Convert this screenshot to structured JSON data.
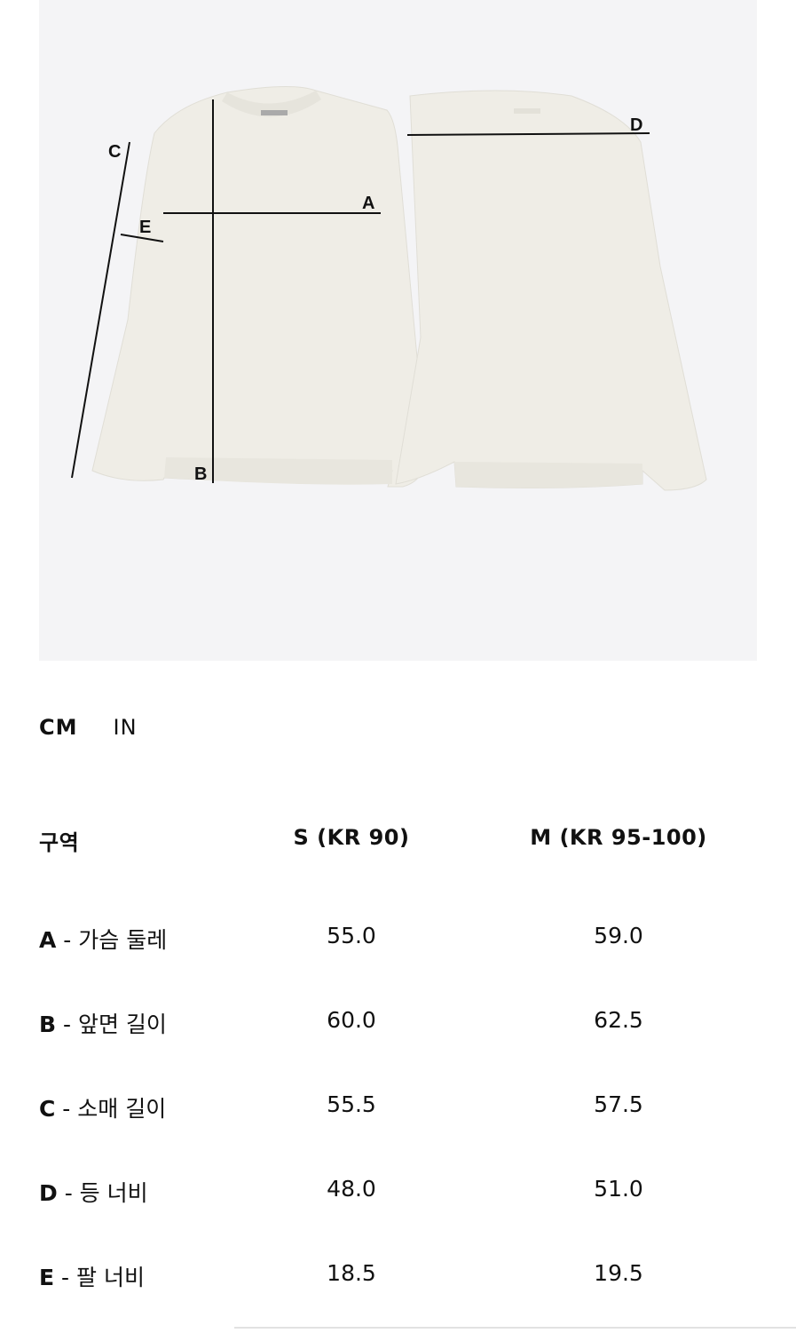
{
  "figure": {
    "labels": {
      "a": "A",
      "b": "B",
      "c": "C",
      "d": "D",
      "e": "E"
    }
  },
  "units": {
    "cm": "CM",
    "in": "IN"
  },
  "table": {
    "headers": [
      "구역",
      "S (KR 90)",
      "M (KR 95-100)"
    ],
    "rows": [
      {
        "letter": "A",
        "label": " - 가슴 둘레",
        "s": "55.0",
        "m": "59.0"
      },
      {
        "letter": "B",
        "label": " - 앞면 길이",
        "s": "60.0",
        "m": "62.5"
      },
      {
        "letter": "C",
        "label": " - 소매 길이",
        "s": "55.5",
        "m": "57.5"
      },
      {
        "letter": "D",
        "label": " - 등 너비",
        "s": "48.0",
        "m": "51.0"
      },
      {
        "letter": "E",
        "label": " - 팔 너비",
        "s": "18.5",
        "m": "19.5"
      }
    ]
  },
  "colors": {
    "figure_bg": "#f4f4f6",
    "sweater": "#efede6",
    "sweater_shade": "#e3e1d9",
    "line": "#111111"
  }
}
